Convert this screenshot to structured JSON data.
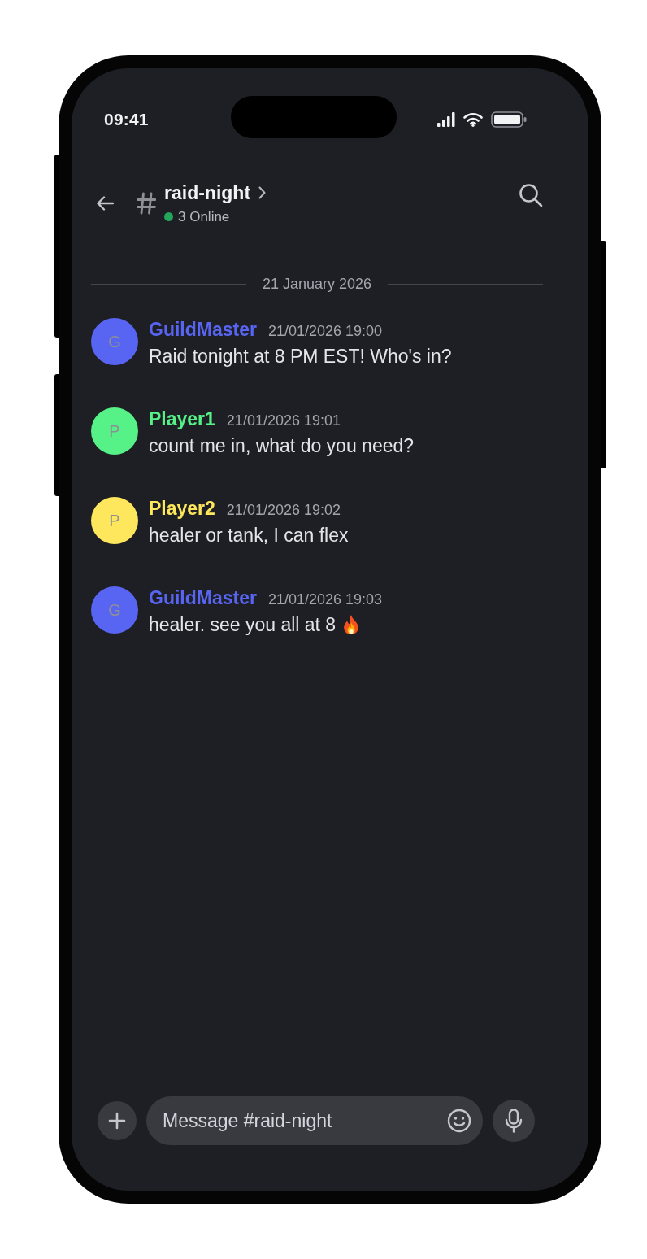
{
  "status_bar": {
    "time": "09:41"
  },
  "header": {
    "channel_name": "raid-night",
    "online_count": "3 Online"
  },
  "date_divider": "21 January 2026",
  "messages": [
    {
      "kind": "plain",
      "author": "GuildMaster",
      "avatar_letter": "G",
      "color": "#5865f2",
      "timestamp": "21/01/2026 19:00",
      "text": "Raid tonight at 8 PM EST! Who's in?"
    },
    {
      "kind": "plain",
      "author": "Player1",
      "avatar_letter": "P",
      "color": "#57f287",
      "timestamp": "21/01/2026 19:01",
      "text": "count me in, what do you need?"
    },
    {
      "kind": "plain",
      "author": "Player2",
      "avatar_letter": "P",
      "color": "#fee75c",
      "timestamp": "21/01/2026 19:02",
      "text": "healer or tank, I can flex"
    },
    {
      "kind": "emoji",
      "author": "GuildMaster",
      "avatar_letter": "G",
      "color": "#5865f2",
      "timestamp": "21/01/2026 19:03",
      "text": "healer. see you all at 8"
    }
  ],
  "composer": {
    "placeholder": "Message #raid-night"
  }
}
